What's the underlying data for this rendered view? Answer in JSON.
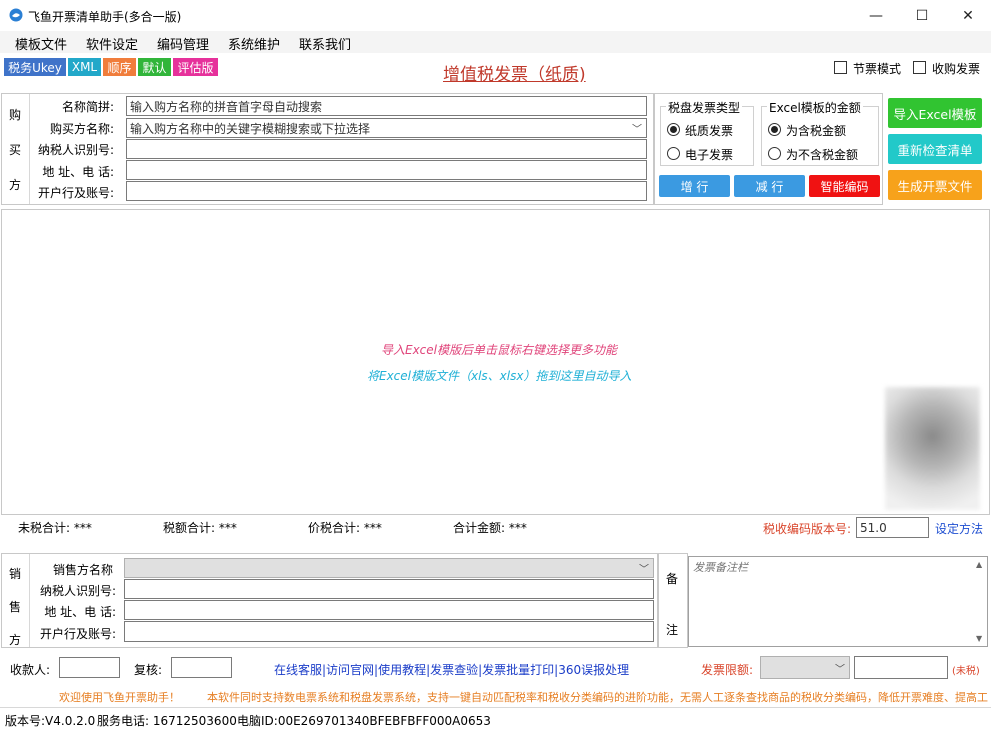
{
  "window": {
    "title": "飞鱼开票清单助手(多合一版)",
    "minimize": "—",
    "maximize": "☐",
    "close": "✕"
  },
  "menu": {
    "items": [
      "模板文件",
      "软件设定",
      "编码管理",
      "系统维护",
      "联系我们"
    ]
  },
  "chips": [
    {
      "label": "税务Ukey",
      "color": "#3f73c9"
    },
    {
      "label": "XML",
      "color": "#22a8c9"
    },
    {
      "label": "顺序",
      "color": "#f07d3c"
    },
    {
      "label": "默认",
      "color": "#31b53a"
    },
    {
      "label": "评估版",
      "color": "#e6319b"
    }
  ],
  "header": {
    "main_title": "增值税发票（纸质)",
    "option_festival": "节票模式",
    "option_purchase": "收购发票"
  },
  "buyer": {
    "side_label": [
      "购",
      "买",
      "方"
    ],
    "fields": [
      {
        "label": "名称简拼:",
        "value": "输入购方名称的拼音首字母自动搜索"
      },
      {
        "label": "购买方名称:",
        "value": "输入购方名称中的关键字模糊搜索或下拉选择"
      },
      {
        "label": "纳税人识别号:",
        "value": ""
      },
      {
        "label": "地 址、电 话:",
        "value": ""
      },
      {
        "label": "开户行及账号:",
        "value": ""
      }
    ]
  },
  "invoice_type": {
    "title": "税盘发票类型",
    "options": [
      "纸质发票",
      "电子发票"
    ],
    "selected": "纸质发票"
  },
  "excel_amount": {
    "title": "Excel模板的金额",
    "options": [
      "为含税金额",
      "为不含税金额"
    ],
    "selected": "为含税金额"
  },
  "buttons": {
    "add_row": "增 行",
    "remove_row": "减 行",
    "smart_code": "智能编码",
    "import_excel": "导入Excel模板",
    "recheck": "重新检查清单",
    "generate": "生成开票文件"
  },
  "grid": {
    "hint_1": "导入Excel模版后单击鼠标右键选择更多功能",
    "hint_2": "将Excel模版文件（xls、xlsx）拖到这里自动导入"
  },
  "totals": {
    "untaxed": "未税合计: ***",
    "tax": "税额合计: ***",
    "with_tax": "价税合计: ***",
    "total": "合计金额: ***",
    "code_version_label": "税收编码版本号:",
    "code_version_value": "51.0",
    "setup_link": "设定方法"
  },
  "seller": {
    "side_label": [
      "销",
      "售",
      "方"
    ],
    "fields": [
      {
        "label": "销售方名称",
        "value": ""
      },
      {
        "label": "纳税人识别号:",
        "value": ""
      },
      {
        "label": "地 址、电 话:",
        "value": ""
      },
      {
        "label": "开户行及账号:",
        "value": ""
      }
    ]
  },
  "remarks": {
    "side_label": [
      "备",
      "注"
    ],
    "placeholder": "发票备注栏"
  },
  "footer": {
    "payee_label": "收款人:",
    "reviewer_label": "复核:",
    "links": "在线客服|访问官网|使用教程|发票查验|发票批量打印|360误报处理",
    "limit_label": "发票限额:",
    "untaxed_note": "(未税)",
    "welcome": "欢迎使用飞鱼开票助手！",
    "marquee": "本软件同时支持数电票系统和税盘发票系统，支持一键自动匹配税率和税收分类编码的进阶功能，无需人工逐条查找商品的税收分类编码，降低开票难度、提高工"
  },
  "statusbar": {
    "version": "版本号:V4.0.2.0",
    "phone": "服务电话: 16712503600",
    "pc_id": "电脑ID:00E269701340BFEBFBFF000A0653"
  },
  "colors": {
    "green": "#31c431",
    "teal": "#22c9c9",
    "orange": "#f7a21b",
    "blue_btn": "#3b9ae1",
    "red_btn": "#f01212",
    "title_red": "#c0392b",
    "hint_pink": "#e0457b",
    "hint_cyan": "#1fb0d6"
  }
}
